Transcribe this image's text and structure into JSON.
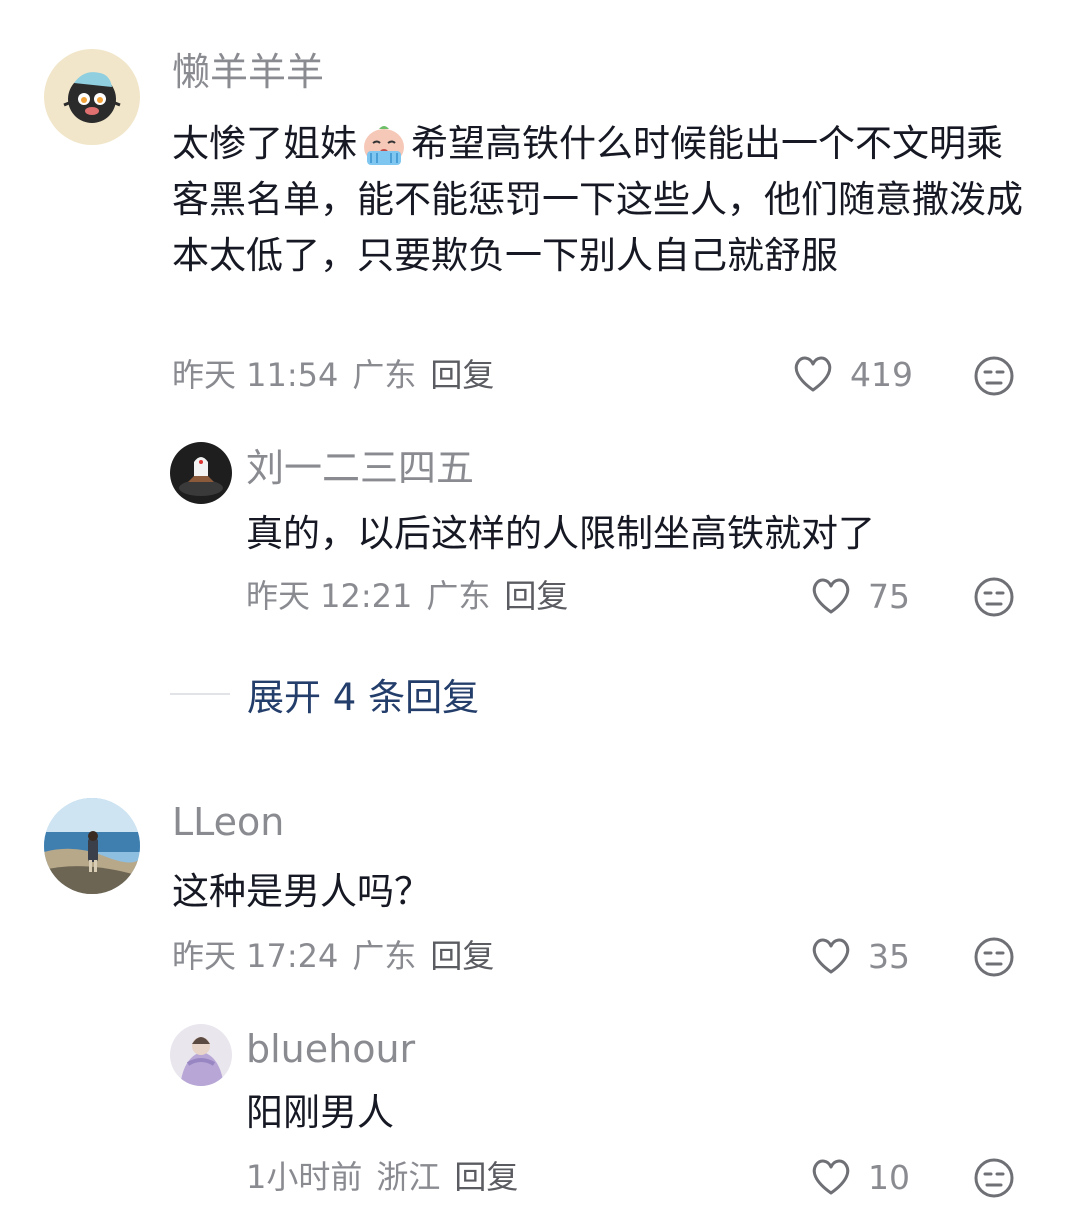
{
  "comments": [
    {
      "username": "懒羊羊羊",
      "text_before_emoji": "太惨了姐妹",
      "emoji": "crying-face-emoji",
      "text_after_emoji": "希望高铁什么时候能出一个不文明乘客黑名单，能不能惩罚一下这些人，他们随意撒泼成本太低了，只要欺负一下别人自己就舒服",
      "time": "昨天 11:54",
      "location": "广东",
      "reply_label": "回复",
      "likes": "419",
      "replies": [
        {
          "username": "刘一二三四五",
          "text": "真的，以后这样的人限制坐高铁就对了",
          "time": "昨天 12:21",
          "location": "广东",
          "reply_label": "回复",
          "likes": "75"
        }
      ],
      "expand_label": "展开 4 条回复"
    },
    {
      "username": "LLeon",
      "text": "这种是男人吗？",
      "time": "昨天 17:24",
      "location": "广东",
      "reply_label": "回复",
      "likes": "35",
      "replies": [
        {
          "username": "bluehour",
          "text": "阳刚男人",
          "time": "1小时前",
          "location": "浙江",
          "reply_label": "回复",
          "likes": "10"
        }
      ]
    }
  ],
  "colors": {
    "username": "#8a8b91",
    "text": "#161823",
    "meta": "#8a8b91",
    "expand": "#243e6b"
  }
}
